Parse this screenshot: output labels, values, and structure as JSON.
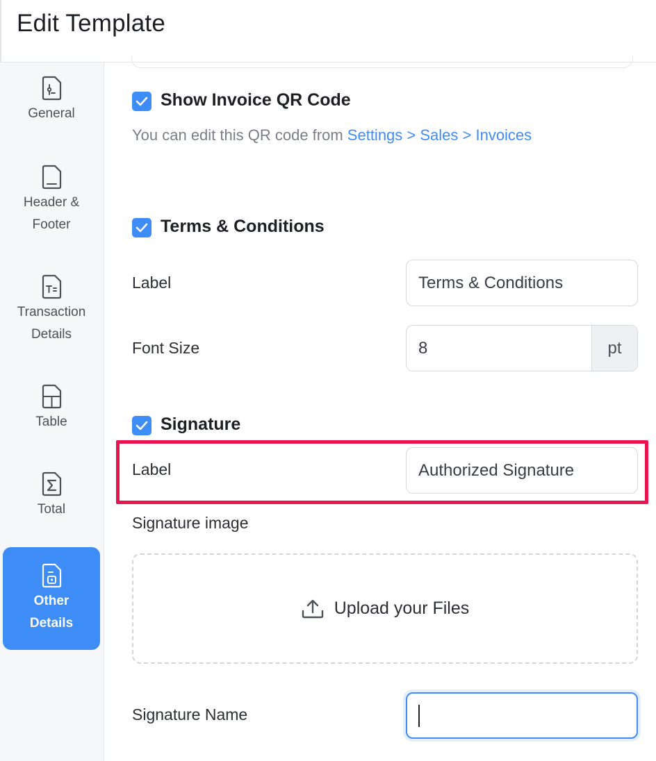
{
  "header": {
    "title": "Edit Template"
  },
  "sidebar": {
    "items": [
      {
        "label": "General",
        "icon": "document-settings-icon"
      },
      {
        "label": "Header &\nFooter",
        "icon": "document-icon"
      },
      {
        "label": "Transaction\nDetails",
        "icon": "document-text-icon"
      },
      {
        "label": "Table",
        "icon": "table-icon"
      },
      {
        "label": "Total",
        "icon": "sigma-icon"
      },
      {
        "label": "Other\nDetails",
        "icon": "document-lock-icon",
        "active": true
      }
    ]
  },
  "qr": {
    "title": "Show Invoice QR Code",
    "checked": true,
    "help_prefix": "You can edit this QR code from ",
    "help_link": "Settings > Sales > Invoices"
  },
  "terms": {
    "title": "Terms & Conditions",
    "checked": true,
    "label_field_label": "Label",
    "label_value": "Terms & Conditions",
    "font_size_label": "Font Size",
    "font_size_value": "8",
    "font_size_unit": "pt"
  },
  "signature": {
    "title": "Signature",
    "checked": true,
    "label_field_label": "Label",
    "label_value": "Authorized Signature",
    "image_label": "Signature image",
    "upload_label": "Upload your Files",
    "name_label": "Signature Name",
    "name_value": ""
  },
  "colors": {
    "accent": "#3e8cf5",
    "highlight": "#e8134f"
  }
}
